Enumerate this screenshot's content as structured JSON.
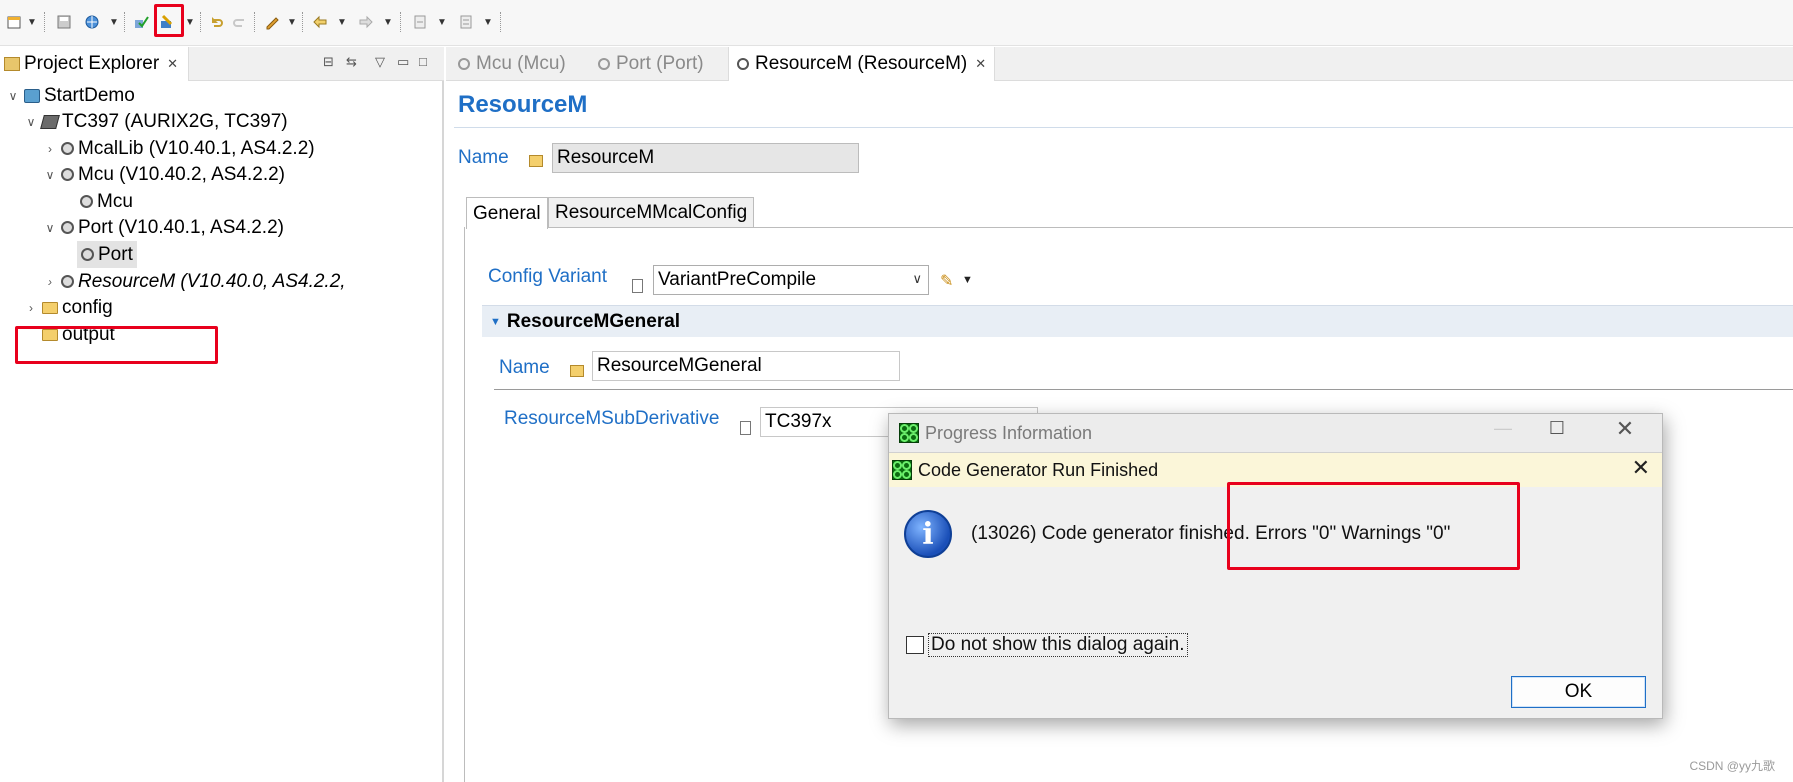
{
  "toolbar": {
    "icons": [
      "new-icon",
      "save-icon",
      "globe-icon",
      "validate-icon",
      "generate-code-icon",
      "undo-icon",
      "redo-icon",
      "edit-icon",
      "back-icon",
      "forward-icon",
      "import-icon",
      "export-icon"
    ]
  },
  "explorer": {
    "title": "Project Explorer",
    "tree": [
      {
        "label": "StartDemo",
        "level": 0,
        "expanded": true,
        "icon": "project-icon"
      },
      {
        "label": "TC397 (AURIX2G, TC397)",
        "level": 1,
        "expanded": true,
        "icon": "chip-icon"
      },
      {
        "label": "McalLib (V10.40.1, AS4.2.2)",
        "level": 2,
        "expanded": false,
        "icon": "module-icon"
      },
      {
        "label": "Mcu (V10.40.2, AS4.2.2)",
        "level": 2,
        "expanded": true,
        "icon": "module-icon"
      },
      {
        "label": "Mcu",
        "level": 3,
        "icon": "module-config-icon"
      },
      {
        "label": "Port (V10.40.1, AS4.2.2)",
        "level": 2,
        "expanded": true,
        "icon": "module-icon"
      },
      {
        "label": "Port",
        "level": 3,
        "icon": "module-config-icon",
        "selected": true
      },
      {
        "label": "ResourceM (V10.40.0, AS4.2.2,",
        "level": 2,
        "expanded": false,
        "icon": "module-icon",
        "italic": true
      },
      {
        "label": "config",
        "level": 1,
        "expanded": false,
        "icon": "folder-icon"
      },
      {
        "label": "output",
        "level": 1,
        "icon": "folder-icon"
      }
    ]
  },
  "editor": {
    "tabs": [
      {
        "label": "Mcu (Mcu)",
        "active": false
      },
      {
        "label": "Port (Port)",
        "active": false
      },
      {
        "label": "ResourceM (ResourceM)",
        "active": true
      }
    ],
    "title": "ResourceM",
    "name_label": "Name",
    "name_value": "ResourceM",
    "inner_tabs": [
      "General",
      "ResourceMMcalConfig"
    ],
    "config_variant_label": "Config Variant",
    "config_variant_value": "VariantPreCompile",
    "section_title": "ResourceMGeneral",
    "section_name_label": "Name",
    "section_name_value": "ResourceMGeneral",
    "subderivative_label": "ResourceMSubDerivative",
    "subderivative_value": "TC397x"
  },
  "progress_dialog": {
    "title": "Progress Information"
  },
  "message_dialog": {
    "title": "Code Generator Run Finished",
    "message": "(13026) Code generator finished. Errors \"0\" Warnings \"0\"",
    "checkbox_label": "Do not show this dialog again.",
    "checkbox_checked": false,
    "ok_label": "OK"
  },
  "watermark": "CSDN @yy九歌",
  "colors": {
    "accent_blue": "#1f6fc6",
    "highlight_red": "#e8001c",
    "dialog_title_bg": "#fbf6d9"
  }
}
